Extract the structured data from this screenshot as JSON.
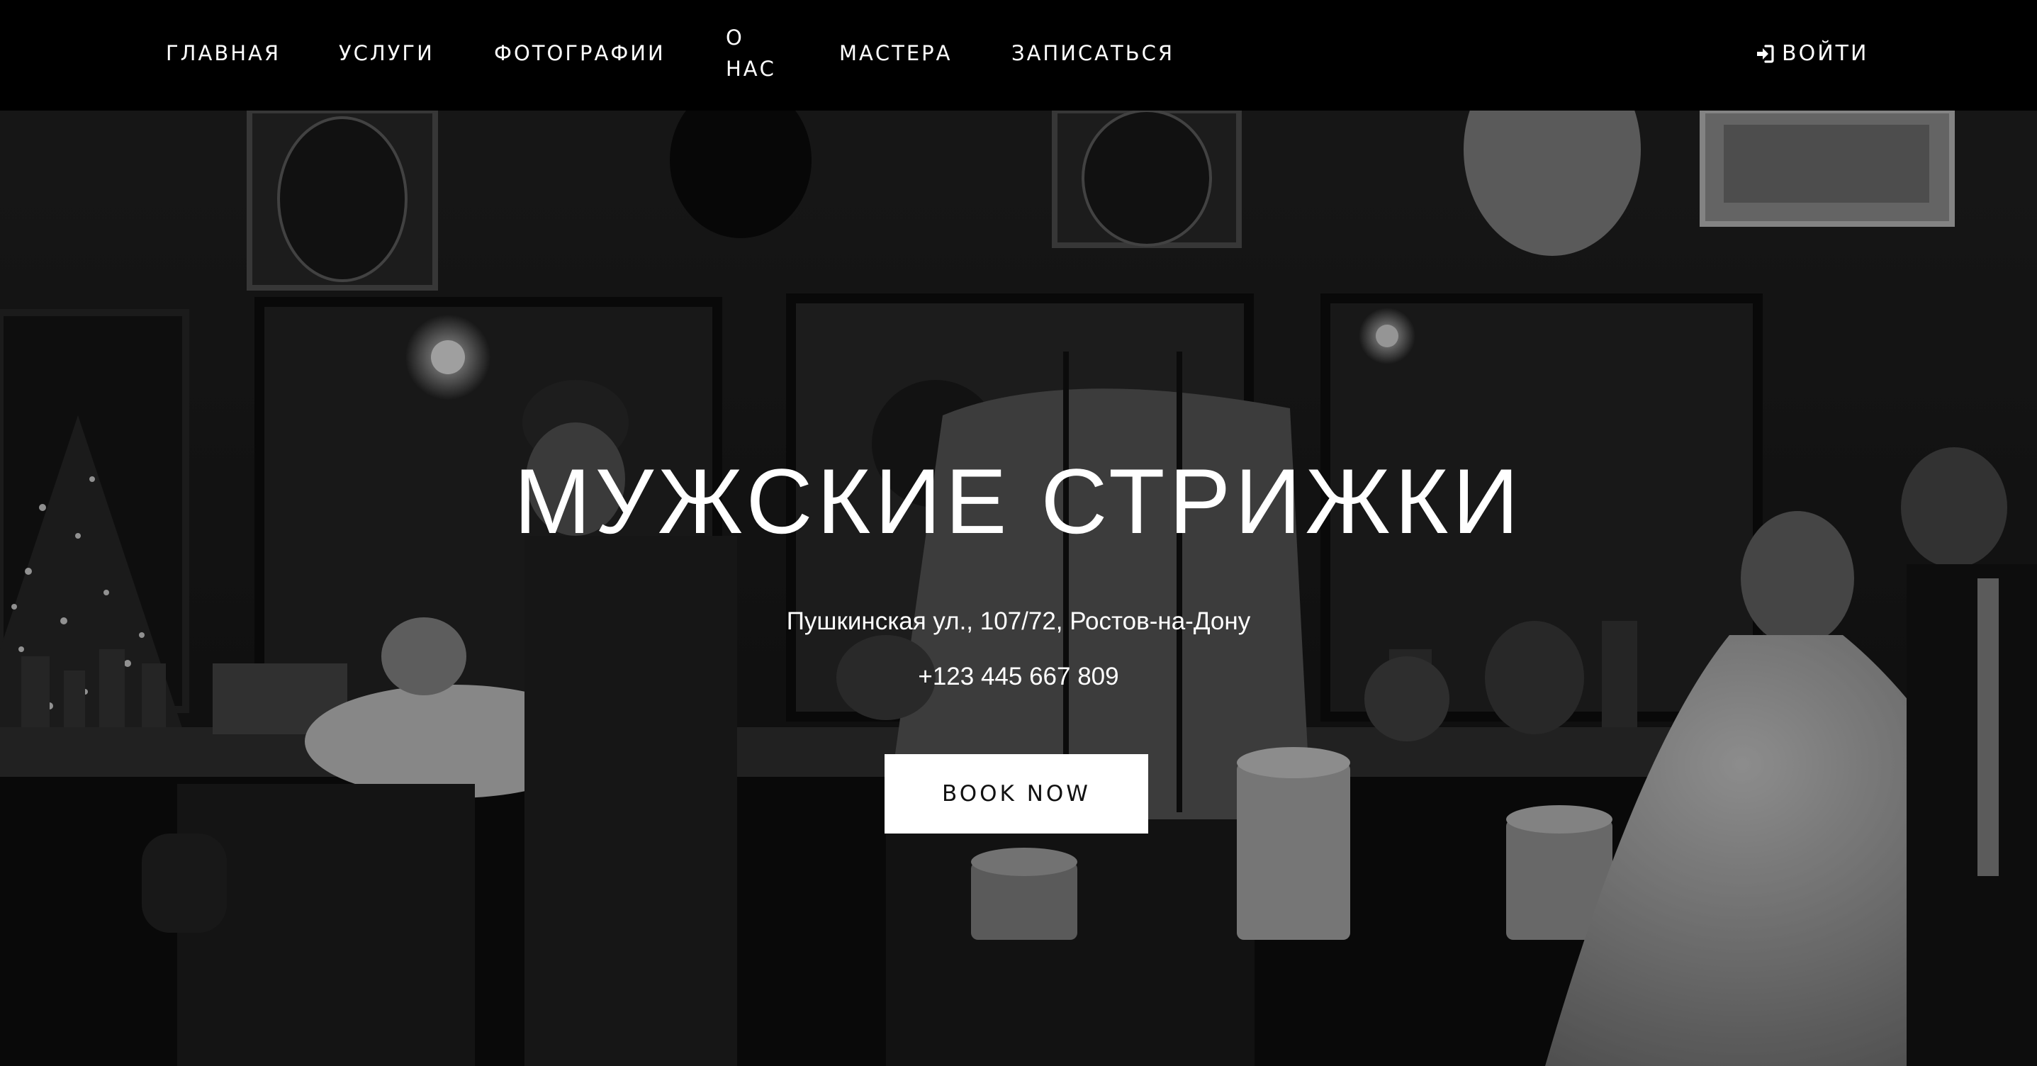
{
  "nav": {
    "items": [
      {
        "label": "ГЛАВНАЯ"
      },
      {
        "label": "УСЛУГИ"
      },
      {
        "label": "ФОТОГРАФИИ"
      },
      {
        "label": "О НАС"
      },
      {
        "label": "МАСТЕРА"
      },
      {
        "label": "ЗАПИСАТЬСЯ"
      }
    ],
    "login_label": "ВОЙТИ",
    "login_icon": "sign-in-icon"
  },
  "hero": {
    "title": "МУЖСКИЕ СТРИЖКИ",
    "address": "Пушкинская ул., 107/72, Ростов-на-Дону",
    "phone": "+123 445 667 809",
    "cta_label": "BOOK NOW",
    "background": "barbershop-interior-photo"
  },
  "colors": {
    "navbar_bg": "#000000",
    "text": "#ffffff",
    "button_bg": "#ffffff",
    "button_text": "#111111"
  }
}
